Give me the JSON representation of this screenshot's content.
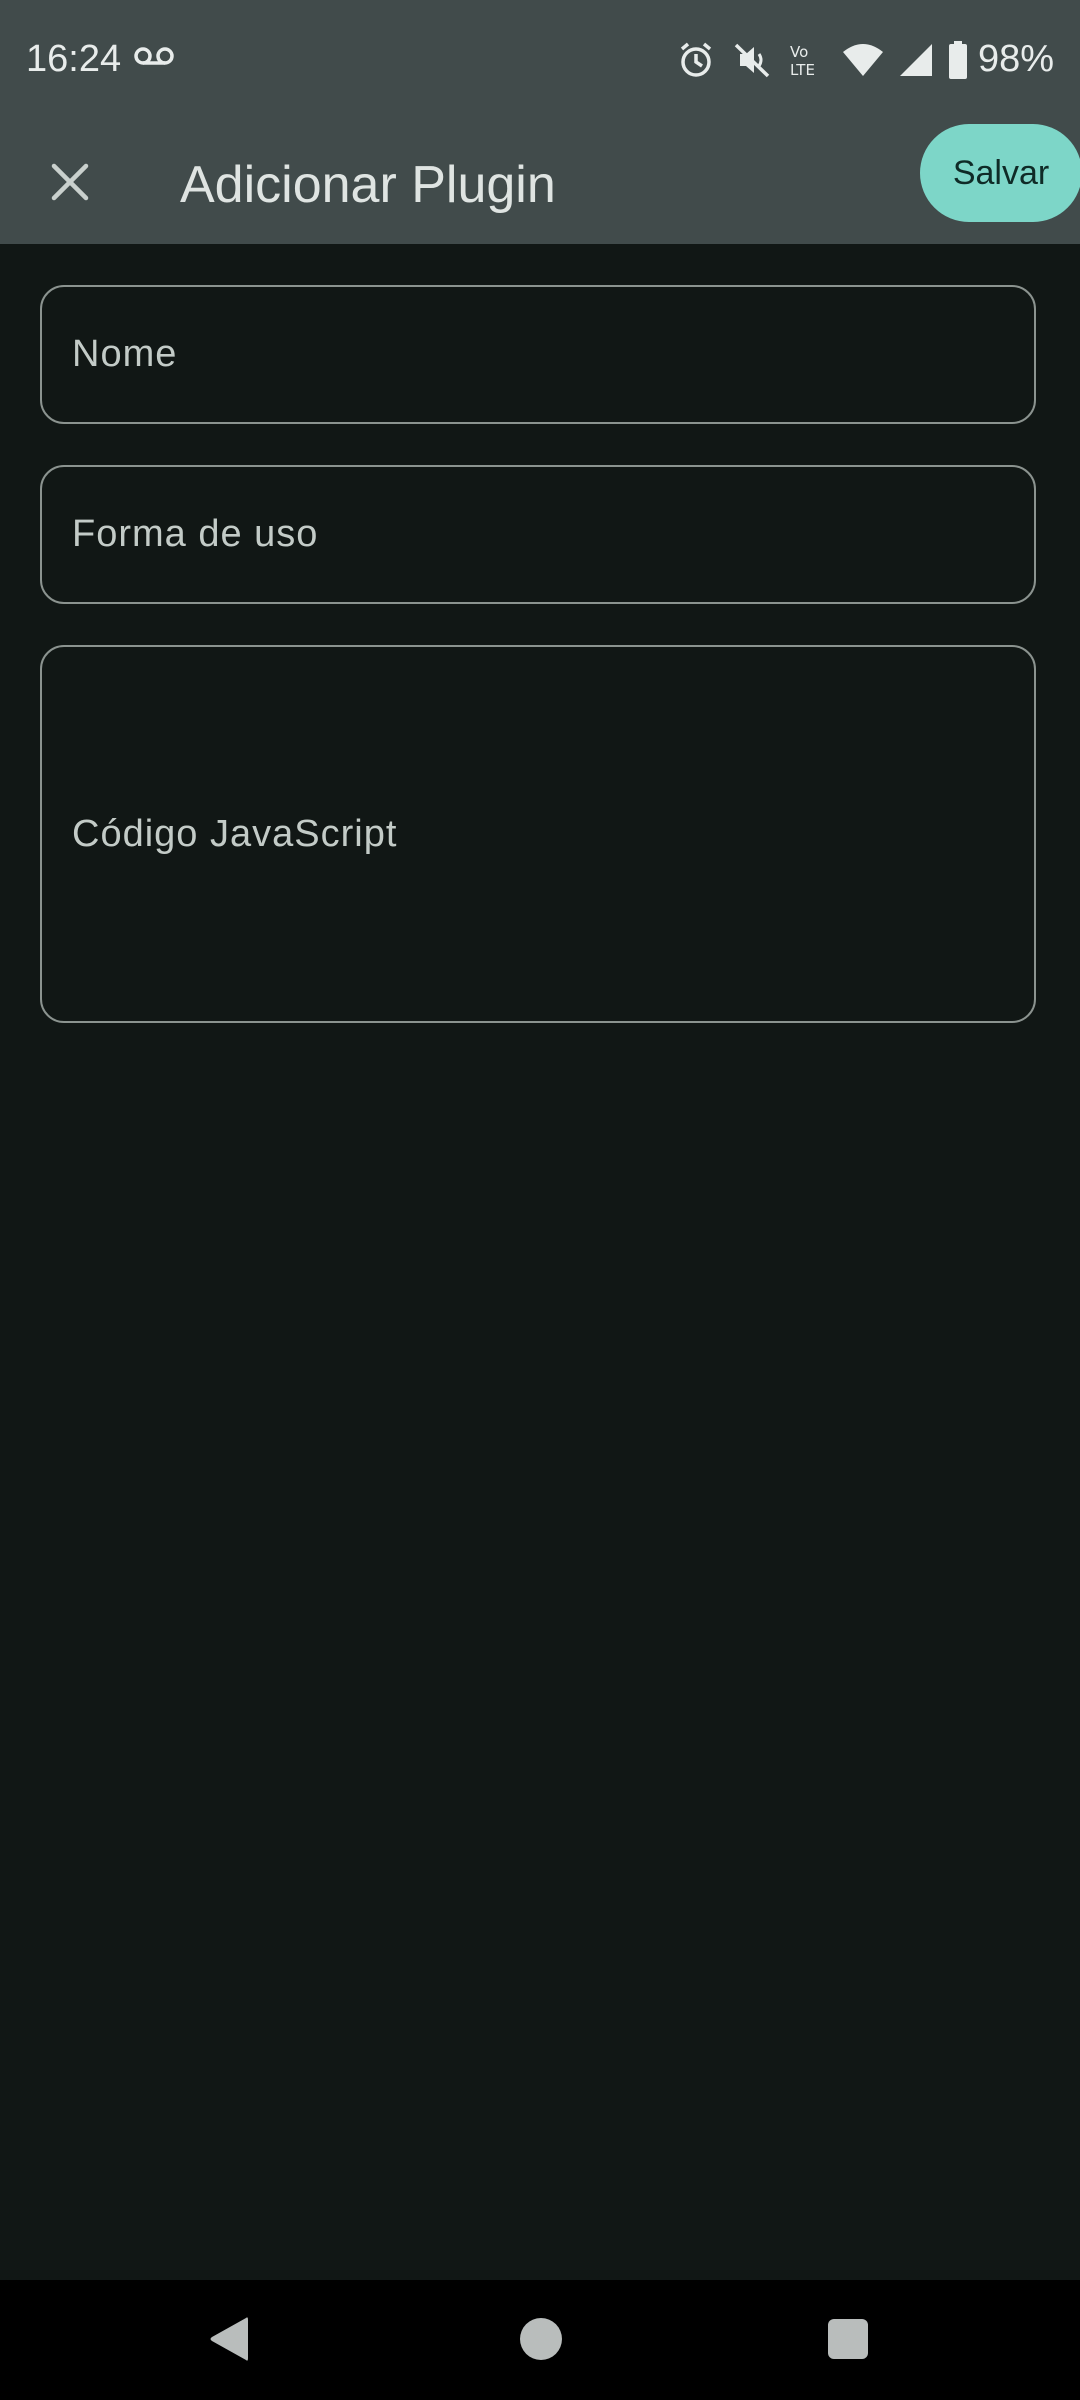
{
  "status_bar": {
    "time": "16:24",
    "battery": "98%",
    "icons": [
      "voicemail-icon",
      "alarm-icon",
      "vibrate-off-icon",
      "volte-icon",
      "wifi-icon",
      "signal-icon",
      "battery-icon"
    ]
  },
  "app_bar": {
    "title": "Adicionar Plugin",
    "save_label": "Salvar",
    "close_icon": "close-icon"
  },
  "form": {
    "name_label": "Nome",
    "usage_label": "Forma de uso",
    "code_label": "Código JavaScript"
  },
  "nav_bar": {
    "icons": [
      "back-icon",
      "home-icon",
      "recents-icon"
    ]
  },
  "colors": {
    "background": "#111715",
    "app_bar": "#414b4b",
    "accent": "#7dd6c8",
    "outline": "#8b938f"
  }
}
